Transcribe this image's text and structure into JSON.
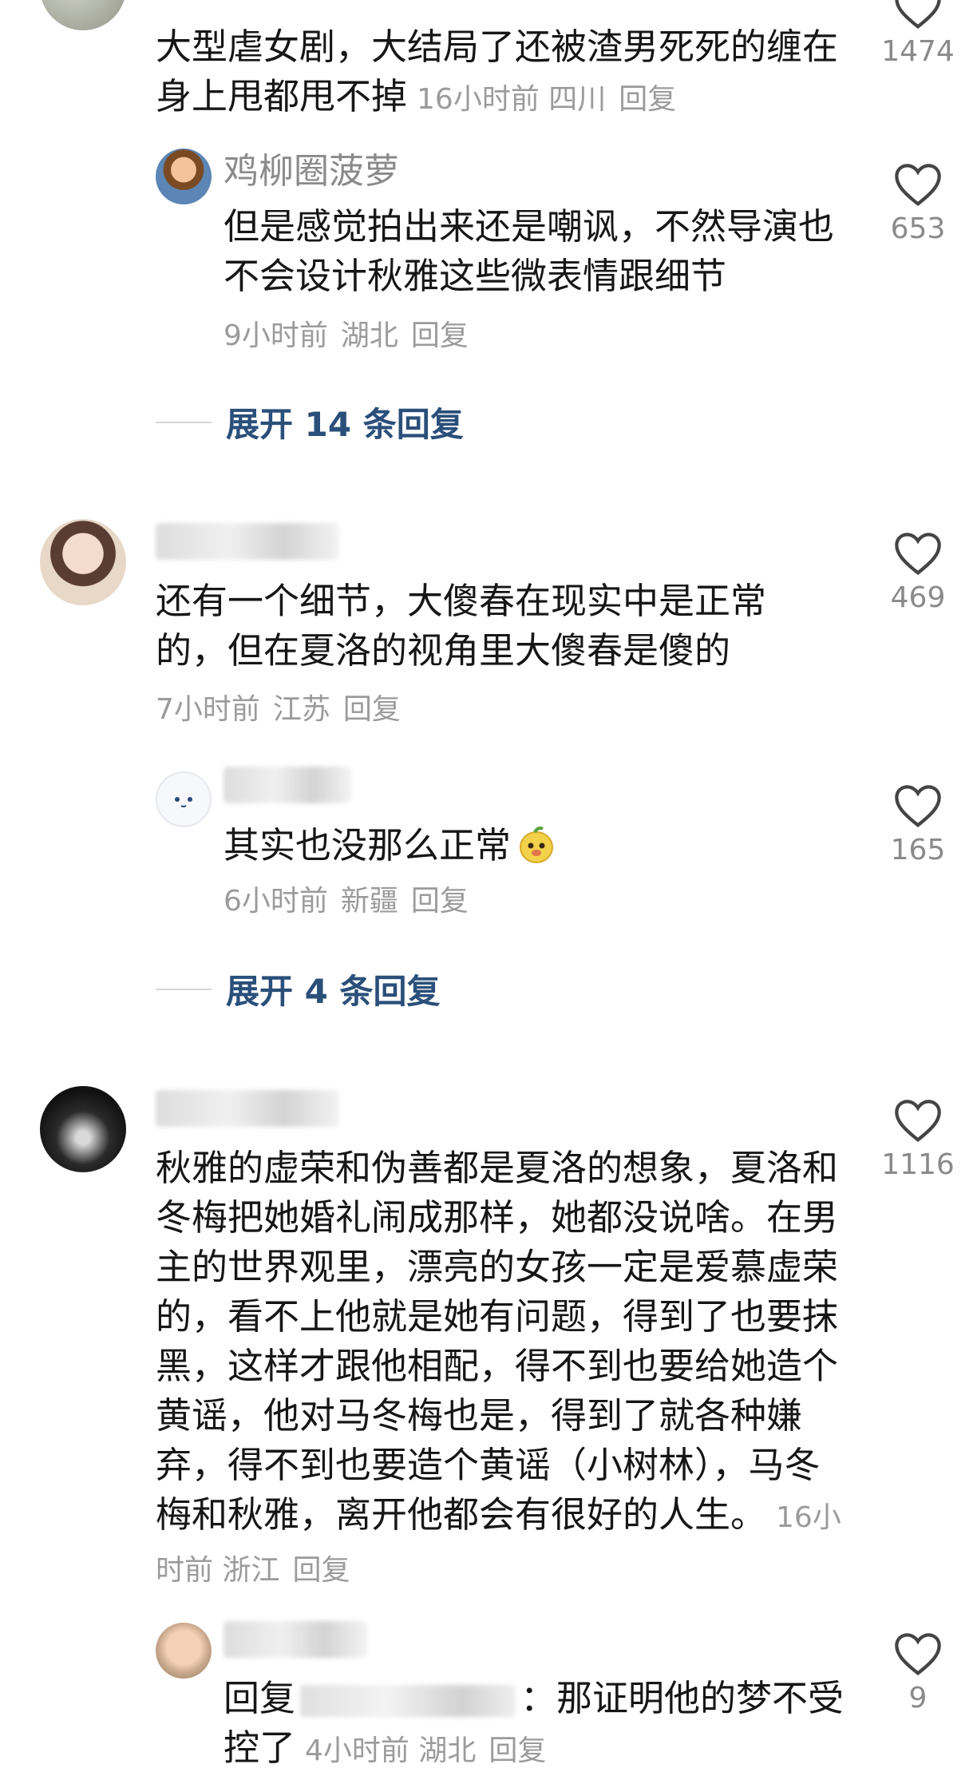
{
  "comments": [
    {
      "body": "大型虐女剧，大结局了还被渣男死死的缠在身上甩都甩不掉",
      "time": "16小时前",
      "region": "四川",
      "reply_label": "回复",
      "likes": "1474",
      "replies": [
        {
          "name": "鸡柳圈菠萝",
          "body": "但是感觉拍出来还是嘲讽，不然导演也不会设计秋雅这些微表情跟细节",
          "time": "9小时前",
          "region": "湖北",
          "reply_label": "回复",
          "likes": "653"
        }
      ],
      "expand_label": "展开 14 条回复"
    },
    {
      "body": "还有一个细节，大傻春在现实中是正常的，但在夏洛的视角里大傻春是傻的",
      "time": "7小时前",
      "region": "江苏",
      "reply_label": "回复",
      "likes": "469",
      "replies": [
        {
          "body": "其实也没那么正常",
          "time": "6小时前",
          "region": "新疆",
          "reply_label": "回复",
          "likes": "165"
        }
      ],
      "expand_label": "展开 4 条回复"
    },
    {
      "body": "秋雅的虚荣和伪善都是夏洛的想象，夏洛和冬梅把她婚礼闹成那样，她都没说啥。在男主的世界观里，漂亮的女孩一定是爱慕虚荣的，看不上他就是她有问题，得到了也要抹黑，这样才跟他相配，得不到也要给她造个黄谣，他对马冬梅也是，得到了就各种嫌弃，得不到也要造个黄谣（小树林），马冬梅和秋雅，离开他都会有很好的人生。",
      "time": "16小时前",
      "region": "浙江",
      "reply_label": "回复",
      "likes": "1116",
      "replies": [
        {
          "reply_prefix": "回复",
          "body": "：那证明他的梦不受控了",
          "time": "4小时前",
          "region": "湖北",
          "reply_label": "回复",
          "likes": "9"
        }
      ]
    }
  ]
}
